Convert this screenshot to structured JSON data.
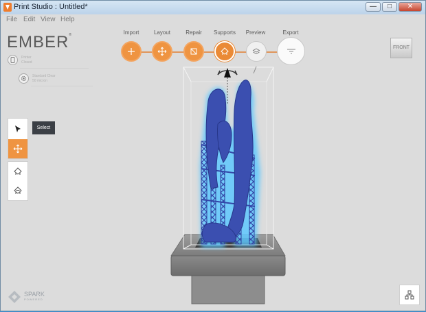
{
  "window": {
    "title": "Print Studio : Untitled*"
  },
  "window_controls": {
    "minimize": "—",
    "maximize": "□",
    "close": "✕"
  },
  "menu": {
    "items": [
      "File",
      "Edit",
      "View",
      "Help"
    ]
  },
  "brand": {
    "logo": "EMBER",
    "trademark": "®"
  },
  "printer": {
    "name": "Printer",
    "status": "Closed"
  },
  "material": {
    "name": "Standard Clear",
    "detail": "50 micron"
  },
  "workflow": {
    "steps": [
      {
        "label": "Import",
        "icon": "plus-icon",
        "state": "done"
      },
      {
        "label": "Layout",
        "icon": "move-icon",
        "state": "done"
      },
      {
        "label": "Repair",
        "icon": "repair-icon",
        "state": "done"
      },
      {
        "label": "Supports",
        "icon": "supports-icon",
        "state": "current"
      },
      {
        "label": "Preview",
        "icon": "layers-icon",
        "state": "pending"
      },
      {
        "label": "Export",
        "icon": "export-icon",
        "state": "pending"
      }
    ],
    "accent_color": "#ef9441"
  },
  "view_cube": {
    "label": "FRONT"
  },
  "tools": {
    "tooltip": "Select",
    "items": [
      {
        "name": "select-tool",
        "icon": "cursor-icon",
        "active": false
      },
      {
        "name": "move-tool",
        "icon": "move-icon",
        "active": true
      },
      {
        "name": "support-add-tool",
        "icon": "support-add-icon",
        "active": false
      },
      {
        "name": "support-remove-tool",
        "icon": "support-remove-icon",
        "active": false
      }
    ]
  },
  "footer": {
    "brand": "SPARK",
    "sub": "POWERED"
  },
  "colors": {
    "model": "#3b4fb0",
    "model_glow": "#5ec8ff",
    "background": "#dcdcdc"
  }
}
